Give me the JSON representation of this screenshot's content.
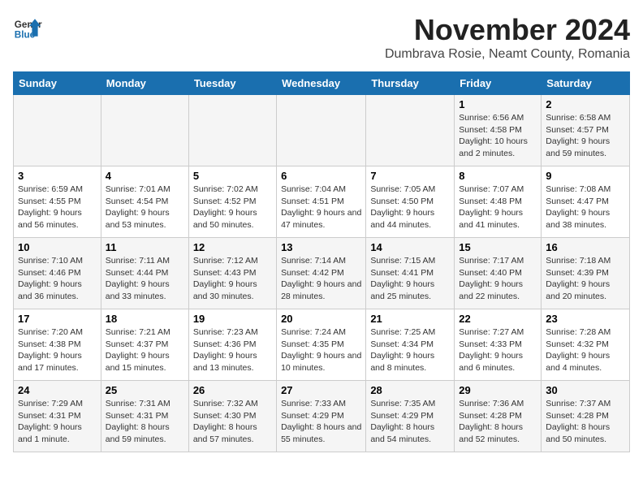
{
  "header": {
    "logo_general": "General",
    "logo_blue": "Blue",
    "month_title": "November 2024",
    "location": "Dumbrava Rosie, Neamt County, Romania"
  },
  "days_of_week": [
    "Sunday",
    "Monday",
    "Tuesday",
    "Wednesday",
    "Thursday",
    "Friday",
    "Saturday"
  ],
  "weeks": [
    [
      {
        "day": "",
        "info": ""
      },
      {
        "day": "",
        "info": ""
      },
      {
        "day": "",
        "info": ""
      },
      {
        "day": "",
        "info": ""
      },
      {
        "day": "",
        "info": ""
      },
      {
        "day": "1",
        "info": "Sunrise: 6:56 AM\nSunset: 4:58 PM\nDaylight: 10 hours and 2 minutes."
      },
      {
        "day": "2",
        "info": "Sunrise: 6:58 AM\nSunset: 4:57 PM\nDaylight: 9 hours and 59 minutes."
      }
    ],
    [
      {
        "day": "3",
        "info": "Sunrise: 6:59 AM\nSunset: 4:55 PM\nDaylight: 9 hours and 56 minutes."
      },
      {
        "day": "4",
        "info": "Sunrise: 7:01 AM\nSunset: 4:54 PM\nDaylight: 9 hours and 53 minutes."
      },
      {
        "day": "5",
        "info": "Sunrise: 7:02 AM\nSunset: 4:52 PM\nDaylight: 9 hours and 50 minutes."
      },
      {
        "day": "6",
        "info": "Sunrise: 7:04 AM\nSunset: 4:51 PM\nDaylight: 9 hours and 47 minutes."
      },
      {
        "day": "7",
        "info": "Sunrise: 7:05 AM\nSunset: 4:50 PM\nDaylight: 9 hours and 44 minutes."
      },
      {
        "day": "8",
        "info": "Sunrise: 7:07 AM\nSunset: 4:48 PM\nDaylight: 9 hours and 41 minutes."
      },
      {
        "day": "9",
        "info": "Sunrise: 7:08 AM\nSunset: 4:47 PM\nDaylight: 9 hours and 38 minutes."
      }
    ],
    [
      {
        "day": "10",
        "info": "Sunrise: 7:10 AM\nSunset: 4:46 PM\nDaylight: 9 hours and 36 minutes."
      },
      {
        "day": "11",
        "info": "Sunrise: 7:11 AM\nSunset: 4:44 PM\nDaylight: 9 hours and 33 minutes."
      },
      {
        "day": "12",
        "info": "Sunrise: 7:12 AM\nSunset: 4:43 PM\nDaylight: 9 hours and 30 minutes."
      },
      {
        "day": "13",
        "info": "Sunrise: 7:14 AM\nSunset: 4:42 PM\nDaylight: 9 hours and 28 minutes."
      },
      {
        "day": "14",
        "info": "Sunrise: 7:15 AM\nSunset: 4:41 PM\nDaylight: 9 hours and 25 minutes."
      },
      {
        "day": "15",
        "info": "Sunrise: 7:17 AM\nSunset: 4:40 PM\nDaylight: 9 hours and 22 minutes."
      },
      {
        "day": "16",
        "info": "Sunrise: 7:18 AM\nSunset: 4:39 PM\nDaylight: 9 hours and 20 minutes."
      }
    ],
    [
      {
        "day": "17",
        "info": "Sunrise: 7:20 AM\nSunset: 4:38 PM\nDaylight: 9 hours and 17 minutes."
      },
      {
        "day": "18",
        "info": "Sunrise: 7:21 AM\nSunset: 4:37 PM\nDaylight: 9 hours and 15 minutes."
      },
      {
        "day": "19",
        "info": "Sunrise: 7:23 AM\nSunset: 4:36 PM\nDaylight: 9 hours and 13 minutes."
      },
      {
        "day": "20",
        "info": "Sunrise: 7:24 AM\nSunset: 4:35 PM\nDaylight: 9 hours and 10 minutes."
      },
      {
        "day": "21",
        "info": "Sunrise: 7:25 AM\nSunset: 4:34 PM\nDaylight: 9 hours and 8 minutes."
      },
      {
        "day": "22",
        "info": "Sunrise: 7:27 AM\nSunset: 4:33 PM\nDaylight: 9 hours and 6 minutes."
      },
      {
        "day": "23",
        "info": "Sunrise: 7:28 AM\nSunset: 4:32 PM\nDaylight: 9 hours and 4 minutes."
      }
    ],
    [
      {
        "day": "24",
        "info": "Sunrise: 7:29 AM\nSunset: 4:31 PM\nDaylight: 9 hours and 1 minute."
      },
      {
        "day": "25",
        "info": "Sunrise: 7:31 AM\nSunset: 4:31 PM\nDaylight: 8 hours and 59 minutes."
      },
      {
        "day": "26",
        "info": "Sunrise: 7:32 AM\nSunset: 4:30 PM\nDaylight: 8 hours and 57 minutes."
      },
      {
        "day": "27",
        "info": "Sunrise: 7:33 AM\nSunset: 4:29 PM\nDaylight: 8 hours and 55 minutes."
      },
      {
        "day": "28",
        "info": "Sunrise: 7:35 AM\nSunset: 4:29 PM\nDaylight: 8 hours and 54 minutes."
      },
      {
        "day": "29",
        "info": "Sunrise: 7:36 AM\nSunset: 4:28 PM\nDaylight: 8 hours and 52 minutes."
      },
      {
        "day": "30",
        "info": "Sunrise: 7:37 AM\nSunset: 4:28 PM\nDaylight: 8 hours and 50 minutes."
      }
    ]
  ]
}
